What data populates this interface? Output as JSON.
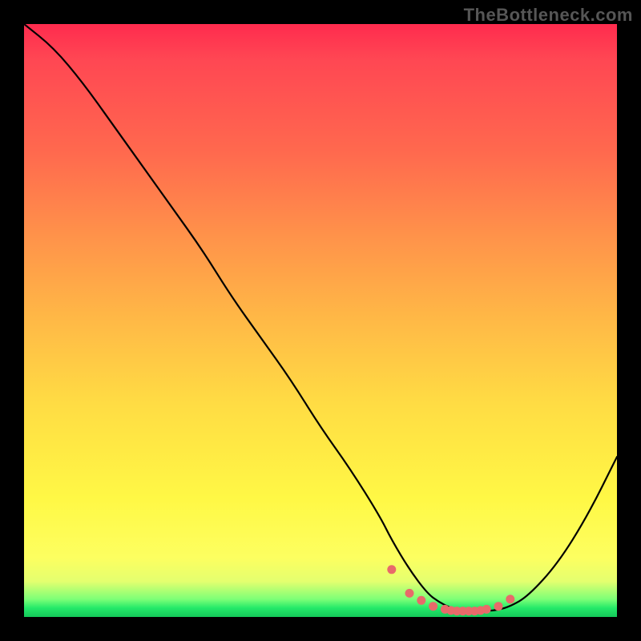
{
  "watermark": "TheBottleneck.com",
  "chart_data": {
    "type": "line",
    "title": "",
    "xlabel": "",
    "ylabel": "",
    "xlim": [
      0,
      100
    ],
    "ylim": [
      0,
      100
    ],
    "background_gradient": {
      "top": "#ff2b4e",
      "mid": "#ffe145",
      "bottom": "#14c85a"
    },
    "series": [
      {
        "name": "bottleneck-curve",
        "x": [
          0,
          5,
          10,
          15,
          20,
          25,
          30,
          35,
          40,
          45,
          50,
          55,
          60,
          62,
          65,
          68,
          70,
          72,
          74,
          76,
          78,
          80,
          82,
          85,
          90,
          95,
          100
        ],
        "y": [
          100,
          96,
          90,
          83,
          76,
          69,
          62,
          54,
          47,
          40,
          32,
          25,
          17,
          13,
          8,
          4,
          2.5,
          1.5,
          1,
          1,
          1,
          1.2,
          1.8,
          3.5,
          9,
          17,
          27
        ]
      },
      {
        "name": "trough-dots",
        "x": [
          62,
          65,
          67,
          69,
          71,
          72,
          73,
          74,
          75,
          76,
          77,
          78,
          80,
          82
        ],
        "y": [
          8,
          4,
          2.8,
          1.8,
          1.3,
          1.1,
          1.0,
          1.0,
          1.0,
          1.0,
          1.1,
          1.3,
          1.8,
          3.0
        ]
      }
    ],
    "colors": {
      "curve": "#000000",
      "dots": "#e86a6a"
    }
  }
}
